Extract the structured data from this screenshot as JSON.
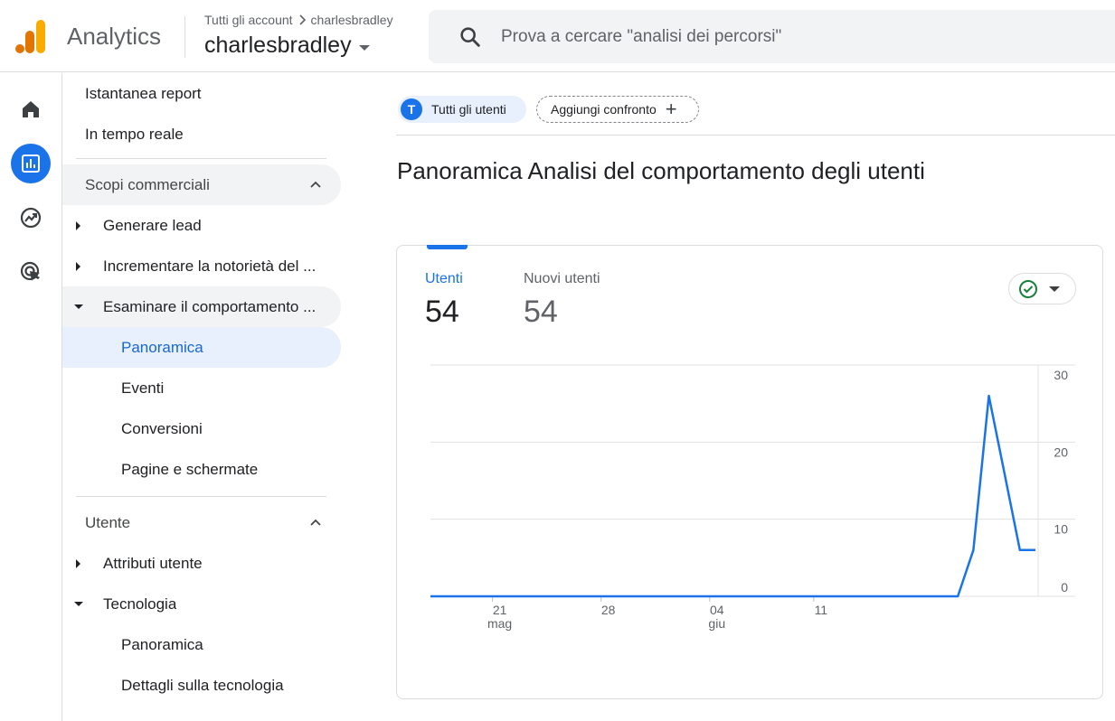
{
  "header": {
    "app_title": "Analytics",
    "breadcrumb_all": "Tutti gli account",
    "breadcrumb_account": "charlesbradley",
    "account_name": "charlesbradley",
    "search_placeholder": "Prova a cercare \"analisi dei percorsi\""
  },
  "rail": {
    "items": [
      {
        "icon": "home-icon"
      },
      {
        "icon": "reports-icon",
        "active": true
      },
      {
        "icon": "explore-icon"
      },
      {
        "icon": "advertising-icon"
      }
    ]
  },
  "sidebar": {
    "snapshot": "Istantanea report",
    "realtime": "In tempo reale",
    "section_business": "Scopi commerciali",
    "lead": "Generare lead",
    "awareness": "Incrementare la notorietà del ...",
    "behavior": "Esaminare il comportamento ...",
    "behavior_overview": "Panoramica",
    "behavior_events": "Eventi",
    "behavior_conversions": "Conversioni",
    "behavior_pages": "Pagine e schermate",
    "section_user": "Utente",
    "user_attributes": "Attributi utente",
    "technology": "Tecnologia",
    "tech_overview": "Panoramica",
    "tech_details": "Dettagli sulla tecnologia"
  },
  "main": {
    "chip_all_users_initial": "T",
    "chip_all_users": "Tutti gli utenti",
    "chip_add_compare": "Aggiungi confronto",
    "page_title": "Panoramica Analisi del comportamento degli utenti",
    "metrics": [
      {
        "label": "Utenti",
        "value": "54",
        "selected": true
      },
      {
        "label": "Nuovi utenti",
        "value": "54"
      }
    ],
    "status_color": "#188038",
    "accent_color": "#1a73e8"
  },
  "chart_data": {
    "type": "line",
    "series": [
      {
        "values": [
          0,
          0,
          0,
          0,
          0,
          0,
          0,
          0,
          0,
          0,
          0,
          0,
          0,
          0,
          0,
          0,
          0,
          0,
          0,
          0,
          0,
          0,
          0,
          0,
          0,
          0,
          0,
          0,
          0,
          0,
          0,
          0,
          0,
          0,
          0,
          6,
          26,
          16,
          6,
          6
        ]
      }
    ],
    "x_ticks": [
      {
        "index": 4,
        "label": "21",
        "sublabel": "mag"
      },
      {
        "index": 11,
        "label": "28",
        "sublabel": ""
      },
      {
        "index": 18,
        "label": "04",
        "sublabel": "giu"
      },
      {
        "index": 25,
        "label": "11",
        "sublabel": ""
      }
    ],
    "y_ticks": [
      "30",
      "20",
      "10",
      "0"
    ],
    "ylim": [
      0,
      30
    ],
    "y_axis_side": "right",
    "grid": true
  }
}
